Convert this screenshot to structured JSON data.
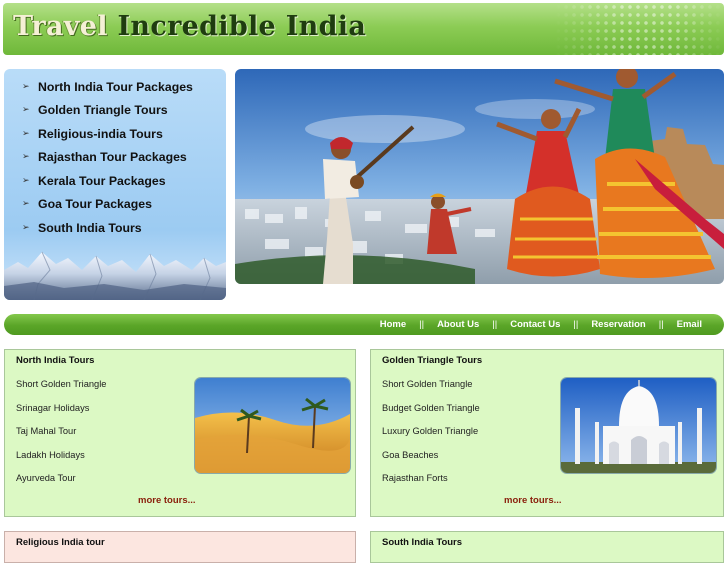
{
  "header": {
    "title_part1": "Travel",
    "title_part2": "Incredible India"
  },
  "sidebar": {
    "items": [
      {
        "label": "North India Tour Packages"
      },
      {
        "label": "Golden Triangle Tours"
      },
      {
        "label": "Religious-india Tours"
      },
      {
        "label": "Rajasthan Tour Packages"
      },
      {
        "label": "Kerala Tour Packages"
      },
      {
        "label": "Goa Tour Packages"
      },
      {
        "label": "South India Tours"
      }
    ],
    "bullet": "➢"
  },
  "nav": {
    "links": [
      "Home",
      "About Us",
      "Contact Us",
      "Reservation",
      "Email"
    ],
    "separator": "||"
  },
  "boxes": {
    "north": {
      "title": "North India Tours",
      "items": [
        "Short Golden Triangle",
        "Srinagar Holidays",
        "Taj Mahal Tour",
        "Ladakh Holidays",
        "Ayurveda Tour"
      ],
      "more": "more tours..."
    },
    "golden": {
      "title": "Golden Triangle Tours",
      "items": [
        "Short Golden Triangle",
        "Budget Golden Triangle",
        "Luxury Golden Triangle",
        "Goa Beaches",
        "Rajasthan Forts"
      ],
      "more": "more tours..."
    },
    "religious": {
      "title": "Religious India tour"
    },
    "south": {
      "title": "South India Tours"
    }
  },
  "colors": {
    "header_green": "#6fb83a",
    "nav_green": "#5aa528",
    "menu_blue": "#9ccbf2",
    "box_green": "#dcf9c4",
    "more_link": "#8a1f0c"
  }
}
